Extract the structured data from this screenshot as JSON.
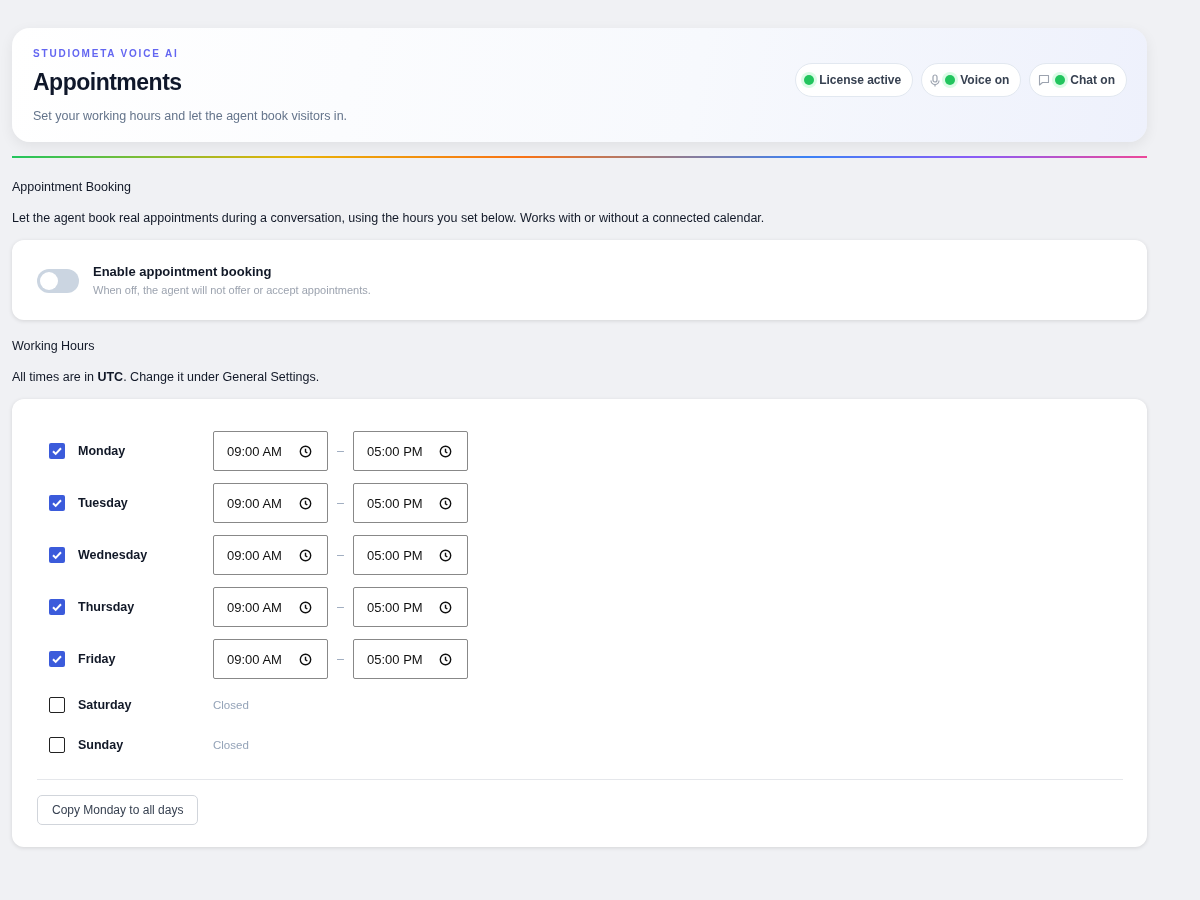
{
  "header": {
    "eyebrow": "STUDIOMETA VOICE AI",
    "title": "Appointments",
    "subtitle": "Set your working hours and let the agent book visitors in.",
    "pills": [
      {
        "kind": "plain",
        "label": "License active",
        "on": true
      },
      {
        "kind": "voice",
        "label": "Voice on",
        "on": true
      },
      {
        "kind": "chat",
        "label": "Chat on",
        "on": true
      }
    ]
  },
  "booking": {
    "heading": "Appointment Booking",
    "description": "Let the agent book real appointments during a conversation, using the hours you set below. Works with or without a connected calendar.",
    "toggle": {
      "label": "Enable appointment booking",
      "hint": "When off, the agent will not offer or accept appointments.",
      "on": false
    }
  },
  "hours": {
    "heading": "Working Hours",
    "note": "All times are in **UTC**. Change it under General Settings.",
    "days": [
      {
        "name": "Monday",
        "checked": true,
        "start": "09:00 AM",
        "separator": "–",
        "end": "05:00 PM"
      },
      {
        "name": "Tuesday",
        "checked": true,
        "start": "09:00 AM",
        "separator": "–",
        "end": "05:00 PM"
      },
      {
        "name": "Wednesday",
        "checked": true,
        "start": "09:00 AM",
        "separator": "–",
        "end": "05:00 PM"
      },
      {
        "name": "Thursday",
        "checked": true,
        "start": "09:00 AM",
        "separator": "–",
        "end": "05:00 PM"
      },
      {
        "name": "Friday",
        "checked": true,
        "start": "09:00 AM",
        "separator": "–",
        "end": "05:00 PM"
      },
      {
        "name": "Saturday",
        "checked": false,
        "closed": "Closed"
      },
      {
        "name": "Sunday",
        "checked": false,
        "closed": "Closed"
      }
    ],
    "copy_button": "Copy Monday to all days"
  }
}
